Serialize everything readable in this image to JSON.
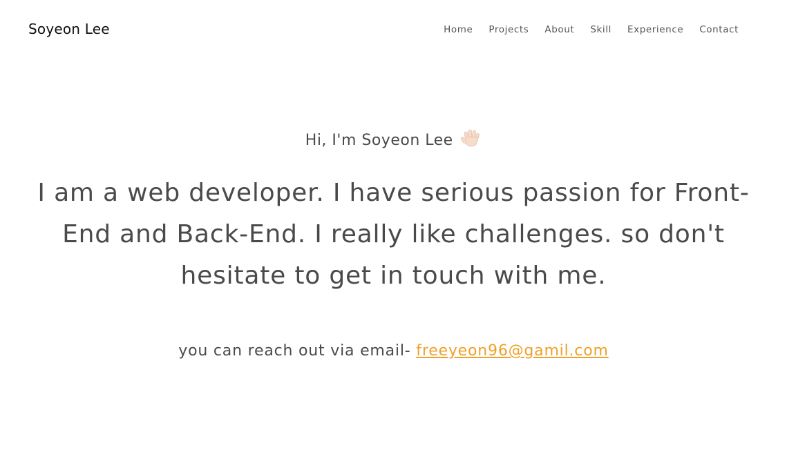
{
  "header": {
    "brand": "Soyeon Lee",
    "nav": [
      {
        "label": "Home"
      },
      {
        "label": "Projects"
      },
      {
        "label": "About"
      },
      {
        "label": "Skill"
      },
      {
        "label": "Experience"
      },
      {
        "label": "Contact"
      }
    ]
  },
  "hero": {
    "greeting": "Hi, I'm Soyeon Lee",
    "greeting_icon": "waving-hand-icon",
    "intro": "I am a web developer. I have serious passion for Front-End and Back-End. I really like challenges. so don't hesitate to get in touch with me.",
    "contact_prefix": "you can reach out via email-",
    "email": "freeyeon96@gamil.com"
  },
  "colors": {
    "text": "#4a4a4a",
    "brand": "#111111",
    "link": "#f0a028",
    "background": "#ffffff"
  }
}
